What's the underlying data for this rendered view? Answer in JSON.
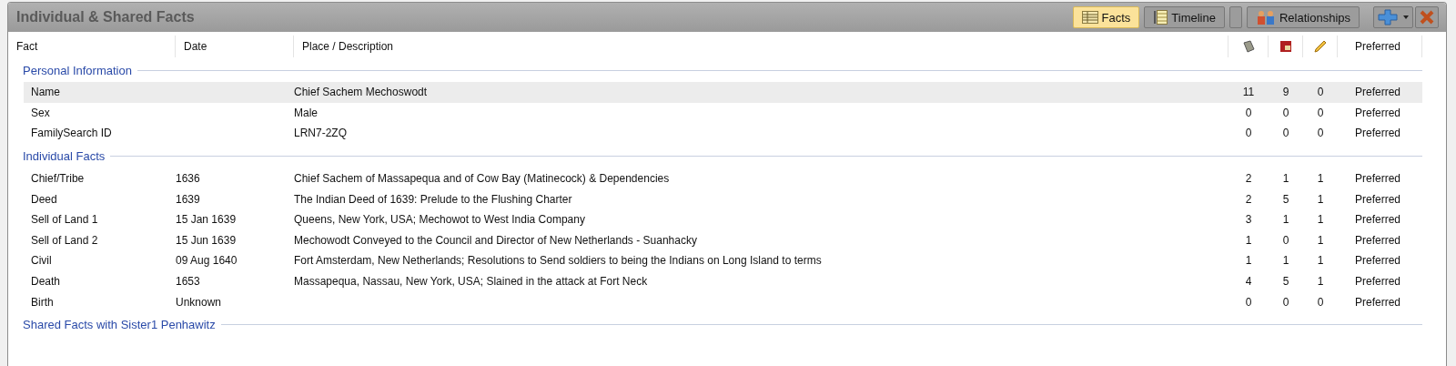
{
  "panel": {
    "title": "Individual & Shared Facts"
  },
  "tabs": [
    {
      "label": "Facts",
      "selected": true
    },
    {
      "label": "Timeline",
      "selected": false
    },
    {
      "label": "Relationships",
      "selected": false
    }
  ],
  "columns": {
    "fact": "Fact",
    "date": "Date",
    "place": "Place / Description",
    "preferred": "Preferred"
  },
  "groups": [
    {
      "title": "Personal Information",
      "rows": [
        {
          "fact": "Name",
          "date": "",
          "place": "Chief Sachem Mechoswodt",
          "sources": "11",
          "media": "9",
          "notes": "0",
          "preferred": "Preferred",
          "selected": true
        },
        {
          "fact": "Sex",
          "date": "",
          "place": "Male",
          "sources": "0",
          "media": "0",
          "notes": "0",
          "preferred": "Preferred",
          "selected": false
        },
        {
          "fact": "FamilySearch ID",
          "date": "",
          "place": "LRN7-2ZQ",
          "sources": "0",
          "media": "0",
          "notes": "0",
          "preferred": "Preferred",
          "selected": false
        }
      ]
    },
    {
      "title": "Individual Facts",
      "rows": [
        {
          "fact": "Chief/Tribe",
          "date": "1636",
          "place": "Chief Sachem of Massapequa and of Cow Bay (Matinecock) & Dependencies",
          "sources": "2",
          "media": "1",
          "notes": "1",
          "preferred": "Preferred",
          "selected": false
        },
        {
          "fact": "Deed",
          "date": "1639",
          "place": "The Indian Deed of 1639: Prelude to the Flushing Charter",
          "sources": "2",
          "media": "5",
          "notes": "1",
          "preferred": "Preferred",
          "selected": false
        },
        {
          "fact": "Sell of Land 1",
          "date": "15 Jan 1639",
          "place": "Queens, New York, USA; Mechowot to West India Company",
          "sources": "3",
          "media": "1",
          "notes": "1",
          "preferred": "Preferred",
          "selected": false
        },
        {
          "fact": "Sell of Land 2",
          "date": "15 Jun 1639",
          "place": "Mechowodt Conveyed to the Council and Director of New Netherlands - Suanhacky",
          "sources": "1",
          "media": "0",
          "notes": "1",
          "preferred": "Preferred",
          "selected": false
        },
        {
          "fact": "Civil",
          "date": "09 Aug 1640",
          "place": "Fort Amsterdam, New Netherlands; Resolutions to Send soldiers to being the Indians on Long Island to terms",
          "sources": "1",
          "media": "1",
          "notes": "1",
          "preferred": "Preferred",
          "selected": false
        },
        {
          "fact": "Death",
          "date": "1653",
          "place": "Massapequa, Nassau, New York, USA; Slained in the attack at Fort Neck",
          "sources": "4",
          "media": "5",
          "notes": "1",
          "preferred": "Preferred",
          "selected": false
        },
        {
          "fact": "Birth",
          "date": "Unknown",
          "place": "",
          "sources": "0",
          "media": "0",
          "notes": "0",
          "preferred": "Preferred",
          "selected": false
        }
      ]
    },
    {
      "title": "Shared Facts with Sister1 Penhawitz"
    }
  ]
}
